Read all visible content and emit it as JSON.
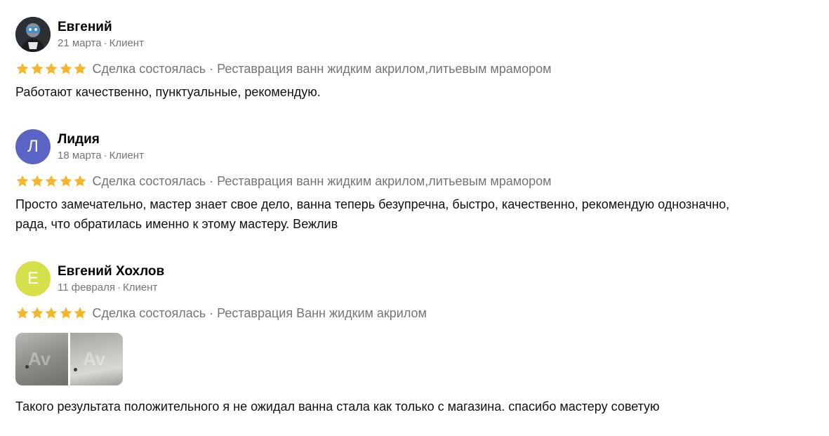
{
  "reviews": [
    {
      "author": "Евгений",
      "avatar_letter": "",
      "avatar_type": "photo",
      "date": "21 марта",
      "role": "Клиент",
      "rating": 5,
      "status": "Сделка состоялась",
      "service": "Реставрация ванн жидким акрилом,литьевым мрамором",
      "text": "Работают качественно, пунктуальные, рекомендую."
    },
    {
      "author": "Лидия",
      "avatar_letter": "Л",
      "avatar_color": "#5a64c4",
      "date": "18 марта",
      "role": "Клиент",
      "rating": 5,
      "status": "Сделка состоялась",
      "service": "Реставрация ванн жидким акрилом,литьевым мрамором",
      "text_line1": "Просто замечательно, мастер знает свое дело, ванна теперь безупречна, быстро, качественно, рекомендую однозначно,",
      "text_line2": "рада, что обратилась именно к этому мастеру. Вежлив"
    },
    {
      "author": "Евгений Хохлов",
      "avatar_letter": "Е",
      "avatar_color": "#d6e04a",
      "date": "11 февраля",
      "role": "Клиент",
      "rating": 5,
      "status": "Сделка состоялась",
      "service": "Реставрация Ванн жидким акрилом",
      "photos_count": 2,
      "text": "Такого результата положительного я не ожидал ванна стала как только с магазина. спасибо мастеру советую"
    }
  ],
  "separator": "·",
  "colors": {
    "star": "#f7b52c",
    "meta": "#757575"
  },
  "icons": {
    "star": "star-icon"
  }
}
